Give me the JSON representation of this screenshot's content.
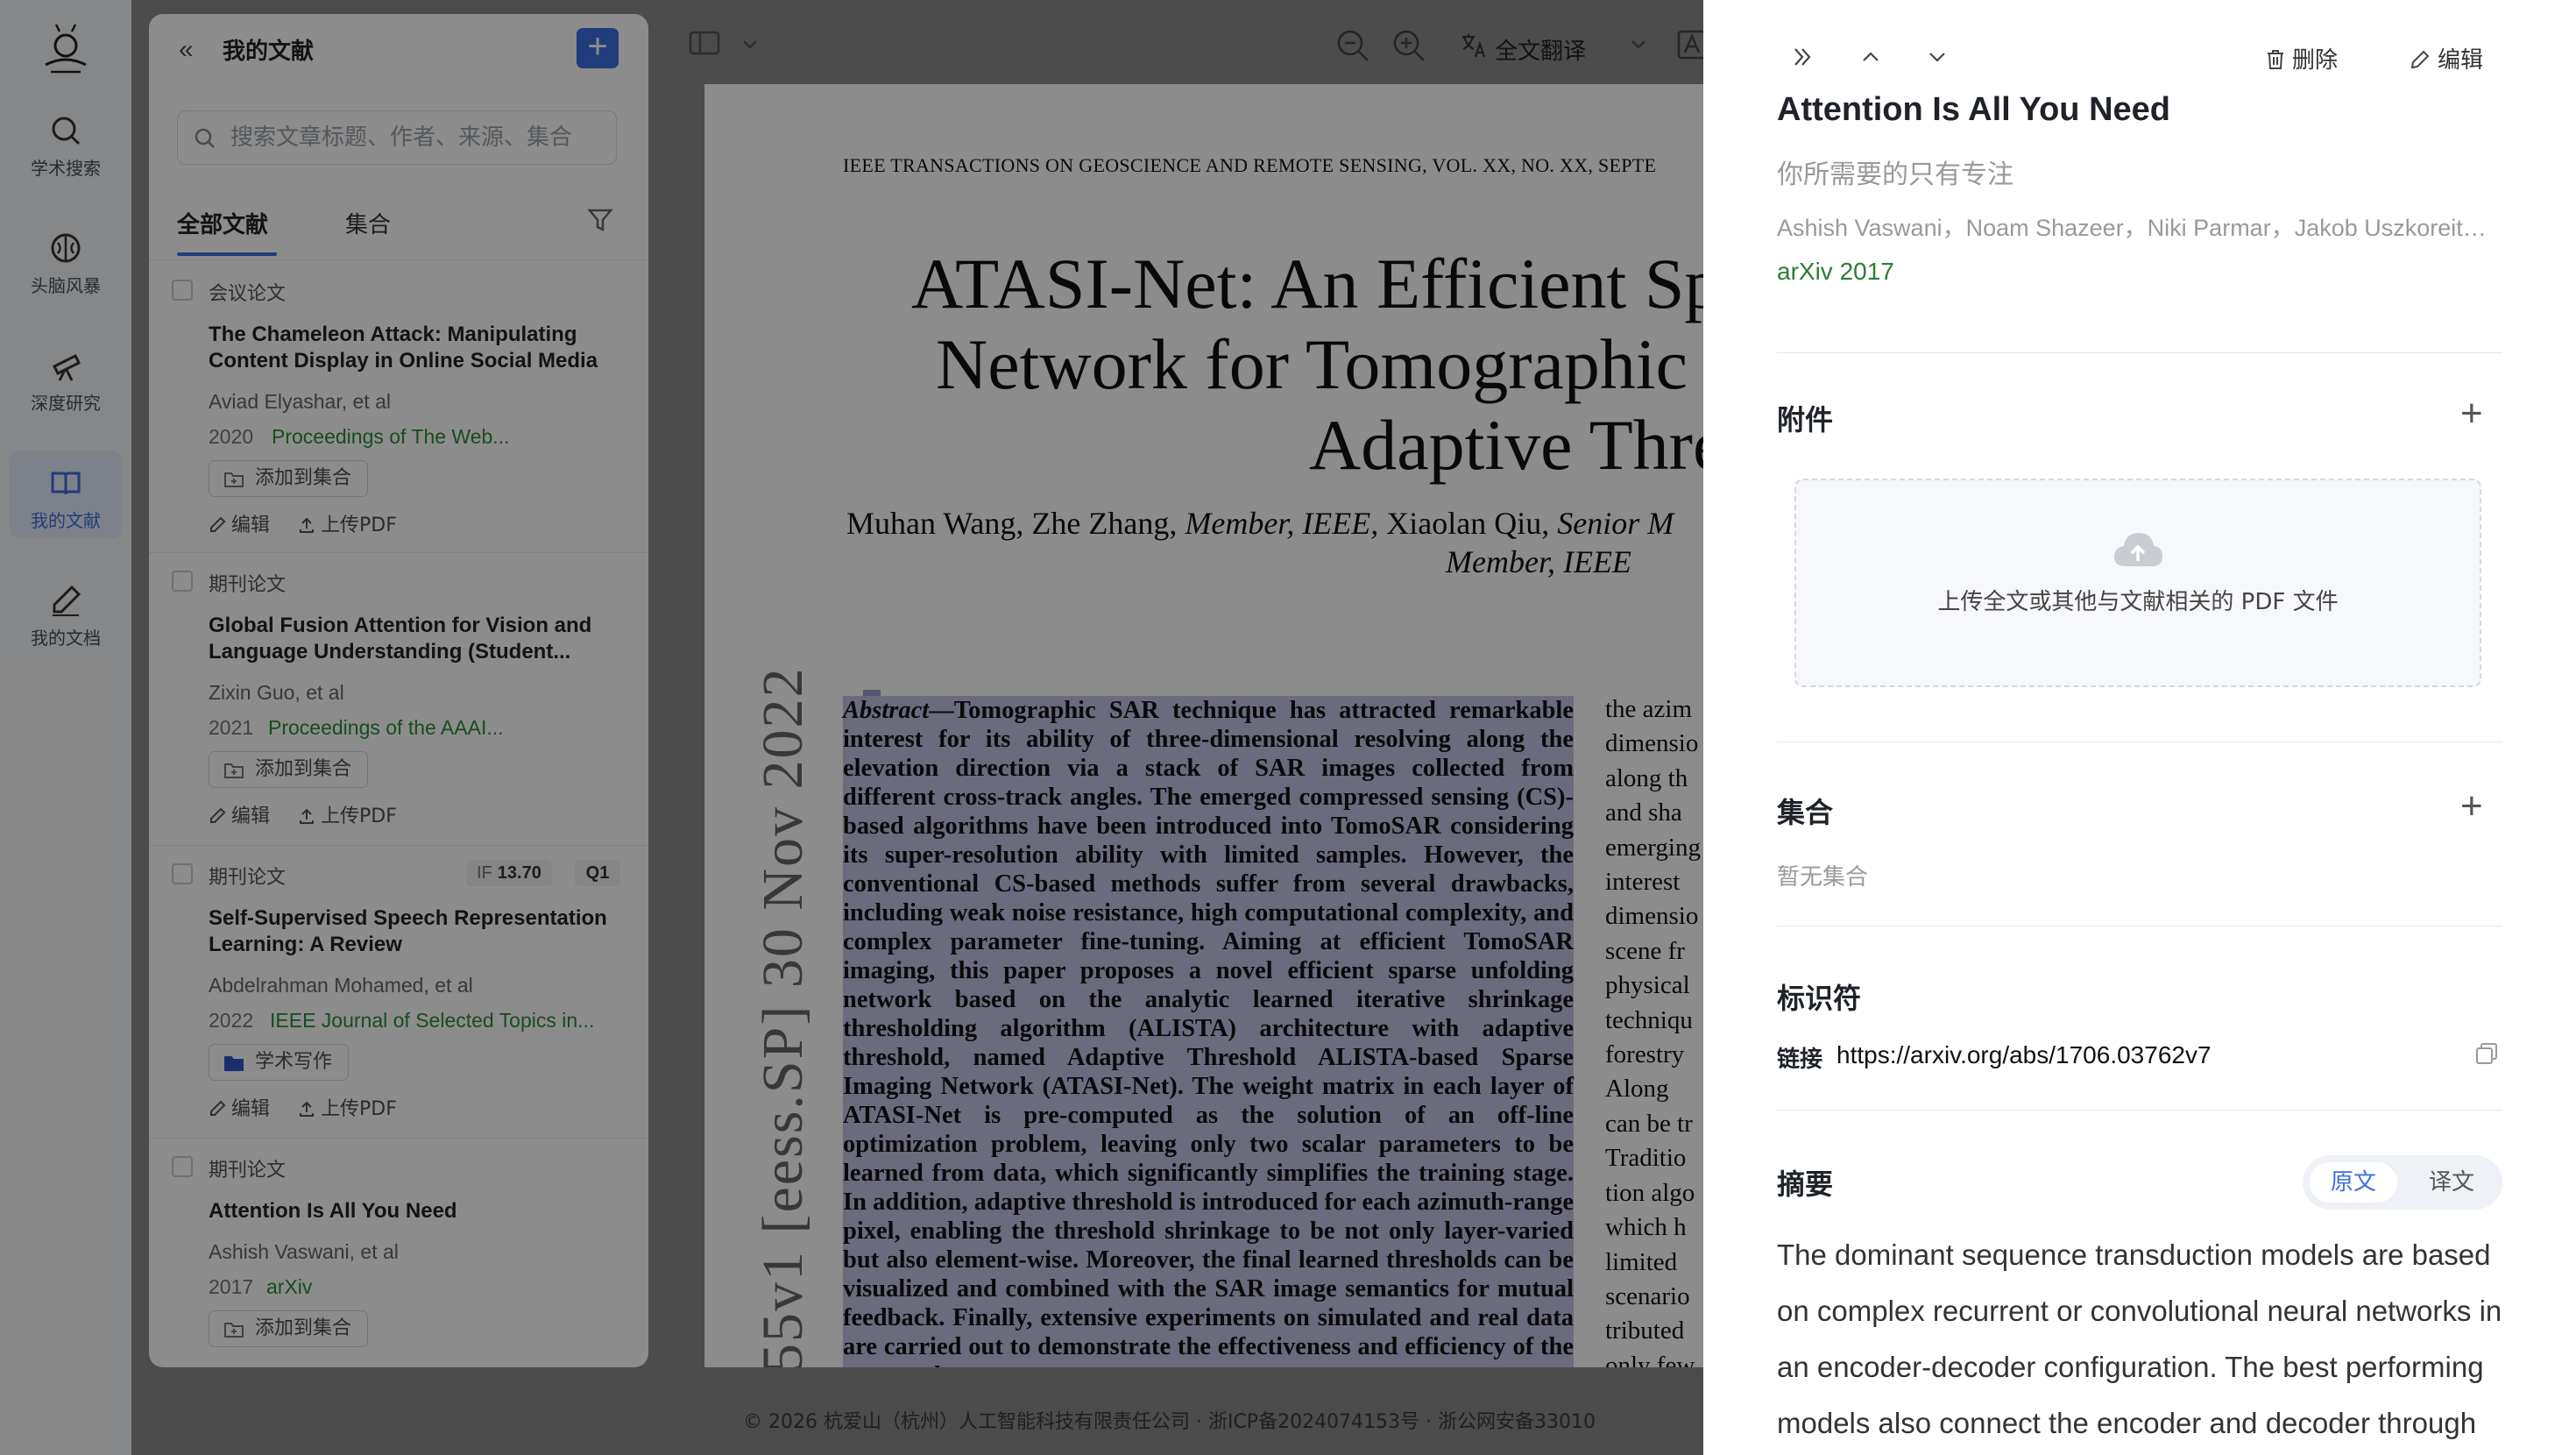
{
  "nav": {
    "items": [
      {
        "label": "学术搜索",
        "icon": "search-icon"
      },
      {
        "label": "头脑风暴",
        "icon": "brain-icon"
      },
      {
        "label": "深度研究",
        "icon": "telescope-icon"
      },
      {
        "label": "我的文献",
        "icon": "book-icon",
        "active": true
      },
      {
        "label": "我的文档",
        "icon": "pen-icon"
      }
    ]
  },
  "library": {
    "title": "我的文献",
    "search_placeholder": "搜索文章标题、作者、来源、集合",
    "tabs": [
      "全部文献",
      "集合"
    ],
    "papers": [
      {
        "type": "会议论文",
        "title": "The Chameleon Attack: Manipulating Content Display in Online Social Media",
        "authors": "Aviad Elyashar, et al",
        "year": "2020",
        "venue": "Proceedings of The Web...",
        "collection_button": "添加到集合",
        "edit": "编辑",
        "upload": "上传PDF"
      },
      {
        "type": "期刊论文",
        "title": "Global Fusion Attention for Vision and Language Understanding (Student...",
        "authors": "Zixin Guo, et al",
        "year": "2021",
        "venue": "Proceedings of the AAAI...",
        "collection_button": "添加到集合",
        "edit": "编辑",
        "upload": "上传PDF"
      },
      {
        "type": "期刊论文",
        "if_label": "IF",
        "if_value": "13.70",
        "quartile": "Q1",
        "title": "Self-Supervised Speech Representation Learning: A Review",
        "authors": "Abdelrahman Mohamed, et al",
        "year": "2022",
        "venue": "IEEE Journal of Selected Topics in...",
        "collection_button": "学术写作",
        "edit": "编辑",
        "upload": "上传PDF"
      },
      {
        "type": "期刊论文",
        "title": "Attention Is All You Need",
        "authors": "Ashish Vaswani, et al",
        "year": "2017",
        "venue": "arXiv",
        "collection_button": "添加到集合"
      }
    ]
  },
  "toolbar": {
    "translate_label": "全文翻译"
  },
  "pdf": {
    "header": "IEEE TRANSACTIONS ON GEOSCIENCE AND REMOTE SENSING, VOL. XX, NO. XX, SEPTE",
    "title_lines": [
      "ATASI-Net: An Efficient Sp",
      "Network for Tomographic",
      "Adaptive Thre"
    ],
    "authors_line1_a": "Muhan Wang, Zhe Zhang, ",
    "authors_line1_b": "Member, IEEE,",
    "authors_line1_c": " Xiaolan Qiu, ",
    "authors_line1_d": "Senior M",
    "authors_line2": "Member, IEEE",
    "side_text": "55v1  [eess.SP]  30 Nov 2022",
    "abstract_label": "Abstract",
    "abstract_text": "—Tomographic SAR technique has attracted remarkable interest for its ability of three-dimensional resolving along the elevation direction via a stack of SAR images collected from different cross-track angles. The emerged compressed sensing (CS)-based algorithms have been introduced into TomoSAR considering its super-resolution ability with limited samples. However, the conventional CS-based methods suffer from several drawbacks, including weak noise resistance, high computational complexity, and complex parameter fine-tuning. Aiming at efficient TomoSAR imaging, this paper proposes a novel efficient sparse unfolding network based on the analytic learned iterative shrinkage thresholding algorithm (ALISTA) architecture with adaptive threshold, named Adaptive Threshold ALISTA-based Sparse Imaging Network (ATASI-Net). The weight matrix in each layer of ATASI-Net is pre-computed as the solution of an off-line optimization problem, leaving only two scalar parameters to be learned from data, which significantly simplifies the training stage. In addition, adaptive threshold is introduced for each azimuth-range pixel, enabling the threshold shrinkage to be not only layer-varied but also element-wise. Moreover, the final learned thresholds can be visualized and combined with the SAR image semantics for mutual feedback. Finally, extensive experiments on simulated and real data are carried out to demonstrate the effectiveness and efficiency of the proposed",
    "col2_lines": [
      "the azim",
      "dimensio",
      "along th",
      "and sha",
      "emerging",
      "interest",
      "dimensio",
      "scene fr",
      "physical",
      "techniqu",
      "forestry",
      "   Along",
      "can be tr",
      "Traditio",
      "tion algo",
      "which h",
      "limited",
      "scenario",
      "tributed",
      "only few"
    ]
  },
  "footer": {
    "text": "© 2026 杭爱山（杭州）人工智能科技有限责任公司  ·  浙ICP备2024074153号  ·  浙公网安备33010"
  },
  "detail": {
    "delete_label": "删除",
    "edit_label": "编辑",
    "title": "Attention Is All You Need",
    "translated_title": "你所需要的只有专注",
    "authors": "Ashish Vaswani，Noam Shazeer，Niki Parmar，Jakob Uszkoreit，Llion Jones",
    "venue": "arXiv 2017",
    "attachments_heading": "附件",
    "upload_text": "上传全文或其他与文献相关的 PDF 文件",
    "collections_heading": "集合",
    "collections_empty": "暂无集合",
    "identifier_heading": "标识符",
    "link_label": "链接",
    "link_value": "https://arxiv.org/abs/1706.03762v7",
    "abstract_heading": "摘要",
    "abstract_toggle": [
      "原文",
      "译文"
    ],
    "abstract_text": "The dominant sequence transduction models are based on complex recurrent or convolutional neural networks in an encoder-decoder configuration. The best performing models also connect the encoder and decoder through"
  }
}
